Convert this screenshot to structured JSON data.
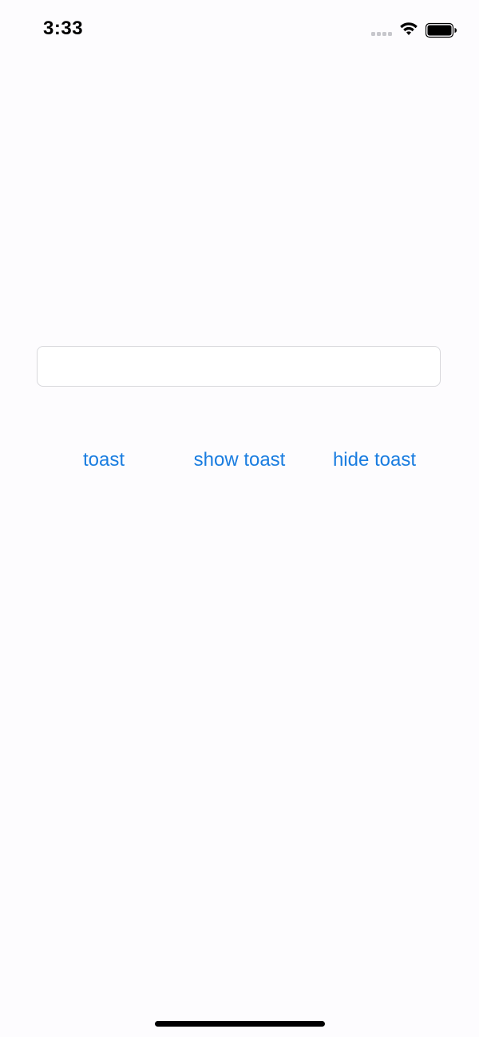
{
  "status_bar": {
    "time": "3:33",
    "signal_icon": "cellular-signal-icon",
    "wifi_icon": "wifi-icon",
    "battery_icon": "battery-icon"
  },
  "text_field": {
    "value": "",
    "placeholder": ""
  },
  "buttons": {
    "toast_label": "toast",
    "show_toast_label": "show toast",
    "hide_toast_label": "hide toast"
  },
  "colors": {
    "accent": "#1a7de0",
    "background": "#fdfcfe"
  }
}
